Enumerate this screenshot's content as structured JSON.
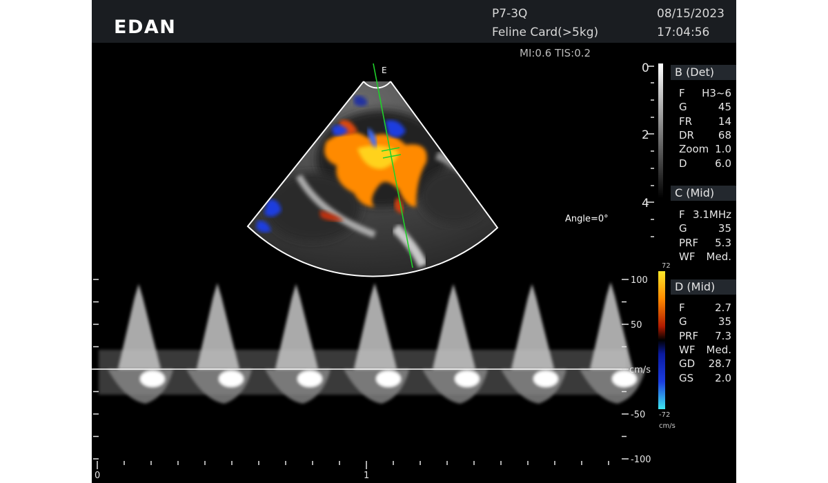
{
  "header": {
    "brand": "EDAN",
    "probe": "P7-3Q",
    "preset": "Feline Card(>5kg)",
    "date": "08/15/2023",
    "time": "17:04:56",
    "safety": "MI:0.6 TIS:0.2"
  },
  "image": {
    "orientation_marker": "E",
    "angle": "Angle=0°"
  },
  "depth_scale": {
    "labels": [
      "0",
      "2",
      "4"
    ]
  },
  "b_mode": {
    "title": "B (Det)",
    "params": [
      {
        "k": "F",
        "v": "H3~6"
      },
      {
        "k": "G",
        "v": "45"
      },
      {
        "k": "FR",
        "v": "14"
      },
      {
        "k": "DR",
        "v": "68"
      },
      {
        "k": "Zoom",
        "v": "1.0"
      },
      {
        "k": "D",
        "v": "6.0"
      }
    ]
  },
  "color_mode": {
    "title": "C (Mid)",
    "params": [
      {
        "k": "F",
        "v": "3.1MHz"
      },
      {
        "k": "G",
        "v": "35"
      },
      {
        "k": "PRF",
        "v": "5.3"
      },
      {
        "k": "WF",
        "v": "Med."
      }
    ]
  },
  "doppler_mode": {
    "title": "D (Mid)",
    "params": [
      {
        "k": "F",
        "v": "2.7"
      },
      {
        "k": "G",
        "v": "35"
      },
      {
        "k": "PRF",
        "v": "7.3"
      },
      {
        "k": "WF",
        "v": "Med."
      },
      {
        "k": "GD",
        "v": "28.7"
      },
      {
        "k": "GS",
        "v": "2.0"
      }
    ]
  },
  "color_bar": {
    "max": "72",
    "min": "-72",
    "unit": "cm/s"
  },
  "spectrum": {
    "velocity_labels": [
      "100",
      "50",
      "cm/s",
      "-50",
      "-100"
    ],
    "time_labels": [
      "0",
      "1"
    ],
    "peak_velocities_cm_s": [
      95,
      96,
      95,
      96,
      95,
      95,
      97
    ]
  },
  "colors": {
    "background": "#000000",
    "header": "#1a1d21",
    "cursor_line": "#1fd12a",
    "baseline": "#ffffff",
    "flow_toward": "#ff8a00",
    "flow_away": "#1b3de0"
  }
}
